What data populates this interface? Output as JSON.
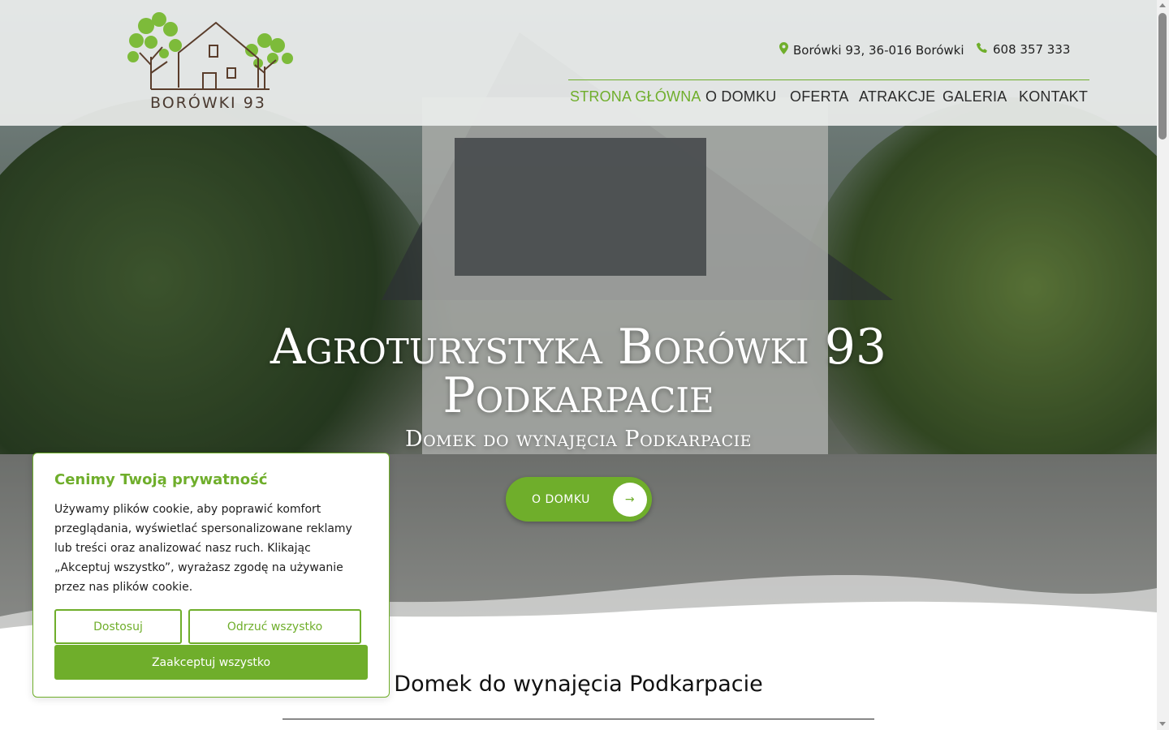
{
  "header": {
    "logo_text": "BORÓWKI 93",
    "address": "Borówki 93, 36-016 Borówki",
    "phone": "608 357 333",
    "nav": [
      {
        "label": "STRONA GŁÓWNA",
        "active": true
      },
      {
        "label": "O DOMKU",
        "active": false
      },
      {
        "label": "OFERTA",
        "active": false
      },
      {
        "label": "ATRAKCJE",
        "active": false
      },
      {
        "label": "GALERIA",
        "active": false
      },
      {
        "label": "KONTAKT",
        "active": false
      }
    ]
  },
  "hero": {
    "title_line1": "Agroturystyka Borówki 93",
    "title_line2": "Podkarpacie",
    "subtitle": "Domek do wynajęcia Podkarpacie",
    "button_label": "O DOMKU"
  },
  "section": {
    "title": "Domek do wynajęcia Podkarpacie"
  },
  "cookie": {
    "title": "Cenimy Twoją prywatność",
    "text": "Używamy plików cookie, aby poprawić komfort przeglądania, wyświetlać spersonalizowane reklamy lub treści oraz analizować nasz ruch. Klikając „Akceptuj wszystko”, wyrażasz zgodę na używanie przez nas plików cookie.",
    "customize_label": "Dostosuj",
    "reject_label": "Odrzuć wszystko",
    "accept_label": "Zaakceptuj wszystko"
  },
  "colors": {
    "accent": "#6fae2b",
    "header_bg": "#ebedec",
    "text_dark": "#222222"
  },
  "icons": {
    "address": "map-marker-icon",
    "phone": "phone-icon",
    "button": "arrow-right-icon"
  }
}
